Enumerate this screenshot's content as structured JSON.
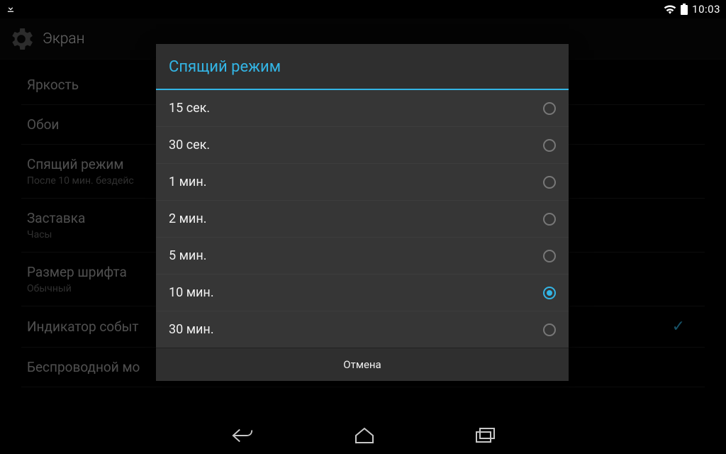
{
  "status_bar": {
    "time": "10:03"
  },
  "action_bar": {
    "title": "Экран"
  },
  "settings": {
    "brightness": "Яркость",
    "wallpaper": "Обои",
    "sleep": "Спящий режим",
    "sleep_sub": "После 10 мин. бездейс",
    "daydream": "Заставка",
    "daydream_sub": "Часы",
    "font_size": "Размер шрифта",
    "font_size_sub": "Обычный",
    "event_indicator": "Индикатор событ",
    "wireless": "Беспроводной мо"
  },
  "dialog": {
    "title": "Спящий режим",
    "options": [
      "15 сек.",
      "30 сек.",
      "1 мин.",
      "2 мин.",
      "5 мин.",
      "10 мин.",
      "30 мин."
    ],
    "selected_index": 5,
    "cancel": "Отмена"
  },
  "colors": {
    "accent": "#33b5e5",
    "dialog_bg": "#363636"
  }
}
